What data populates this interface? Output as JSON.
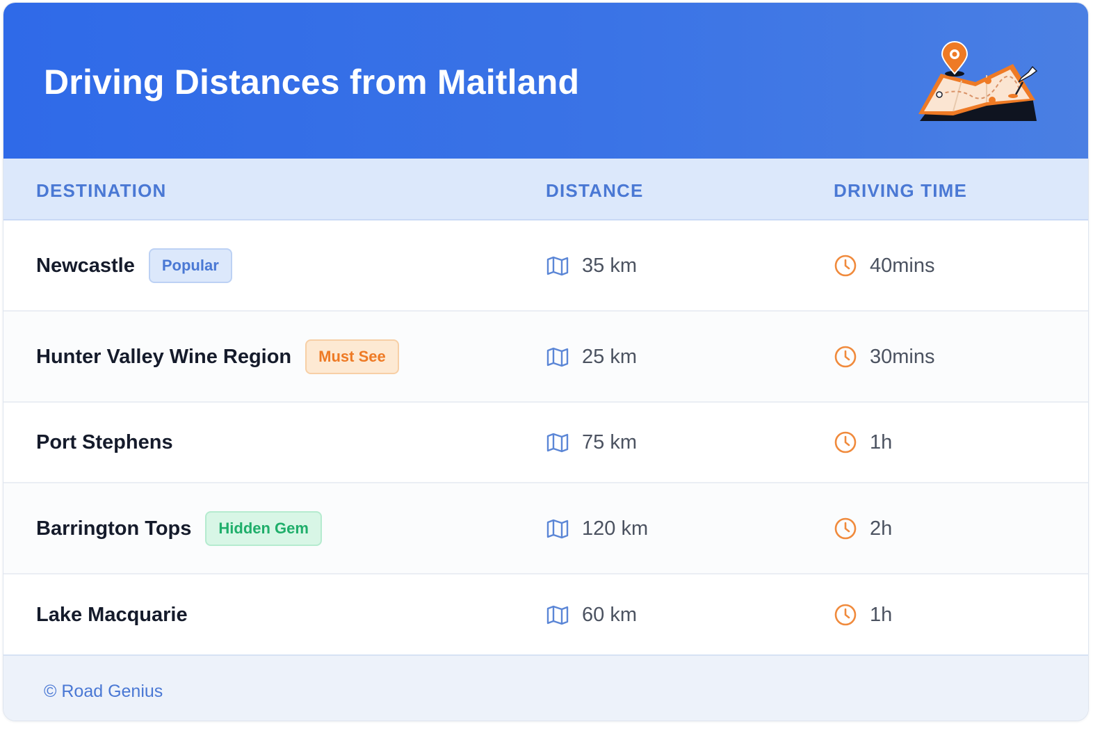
{
  "header": {
    "title": "Driving Distances from Maitland",
    "illustration_icon": "map-pin-illustration"
  },
  "table": {
    "columns": [
      "DESTINATION",
      "DISTANCE",
      "DRIVING TIME"
    ],
    "rows": [
      {
        "destination": "Newcastle",
        "badge": "Popular",
        "distance": "35 km",
        "time": "40mins"
      },
      {
        "destination": "Hunter Valley Wine Region",
        "badge": "Must See",
        "distance": "25 km",
        "time": "30mins"
      },
      {
        "destination": "Port Stephens",
        "badge": "",
        "distance": "75 km",
        "time": "1h"
      },
      {
        "destination": "Barrington Tops",
        "badge": "Hidden Gem",
        "distance": "120 km",
        "time": "2h"
      },
      {
        "destination": "Lake Macquarie",
        "badge": "",
        "distance": "60 km",
        "time": "1h"
      }
    ]
  },
  "footer": {
    "credit": "© Road Genius"
  },
  "colors": {
    "header_blue": "#2f6ae8",
    "accent_blue": "#4a78d4",
    "accent_orange": "#ee7a25",
    "accent_green": "#1fae6a",
    "clock_orange": "#f08a3c"
  },
  "icons": {
    "distance": "map-icon",
    "time": "clock-icon"
  }
}
